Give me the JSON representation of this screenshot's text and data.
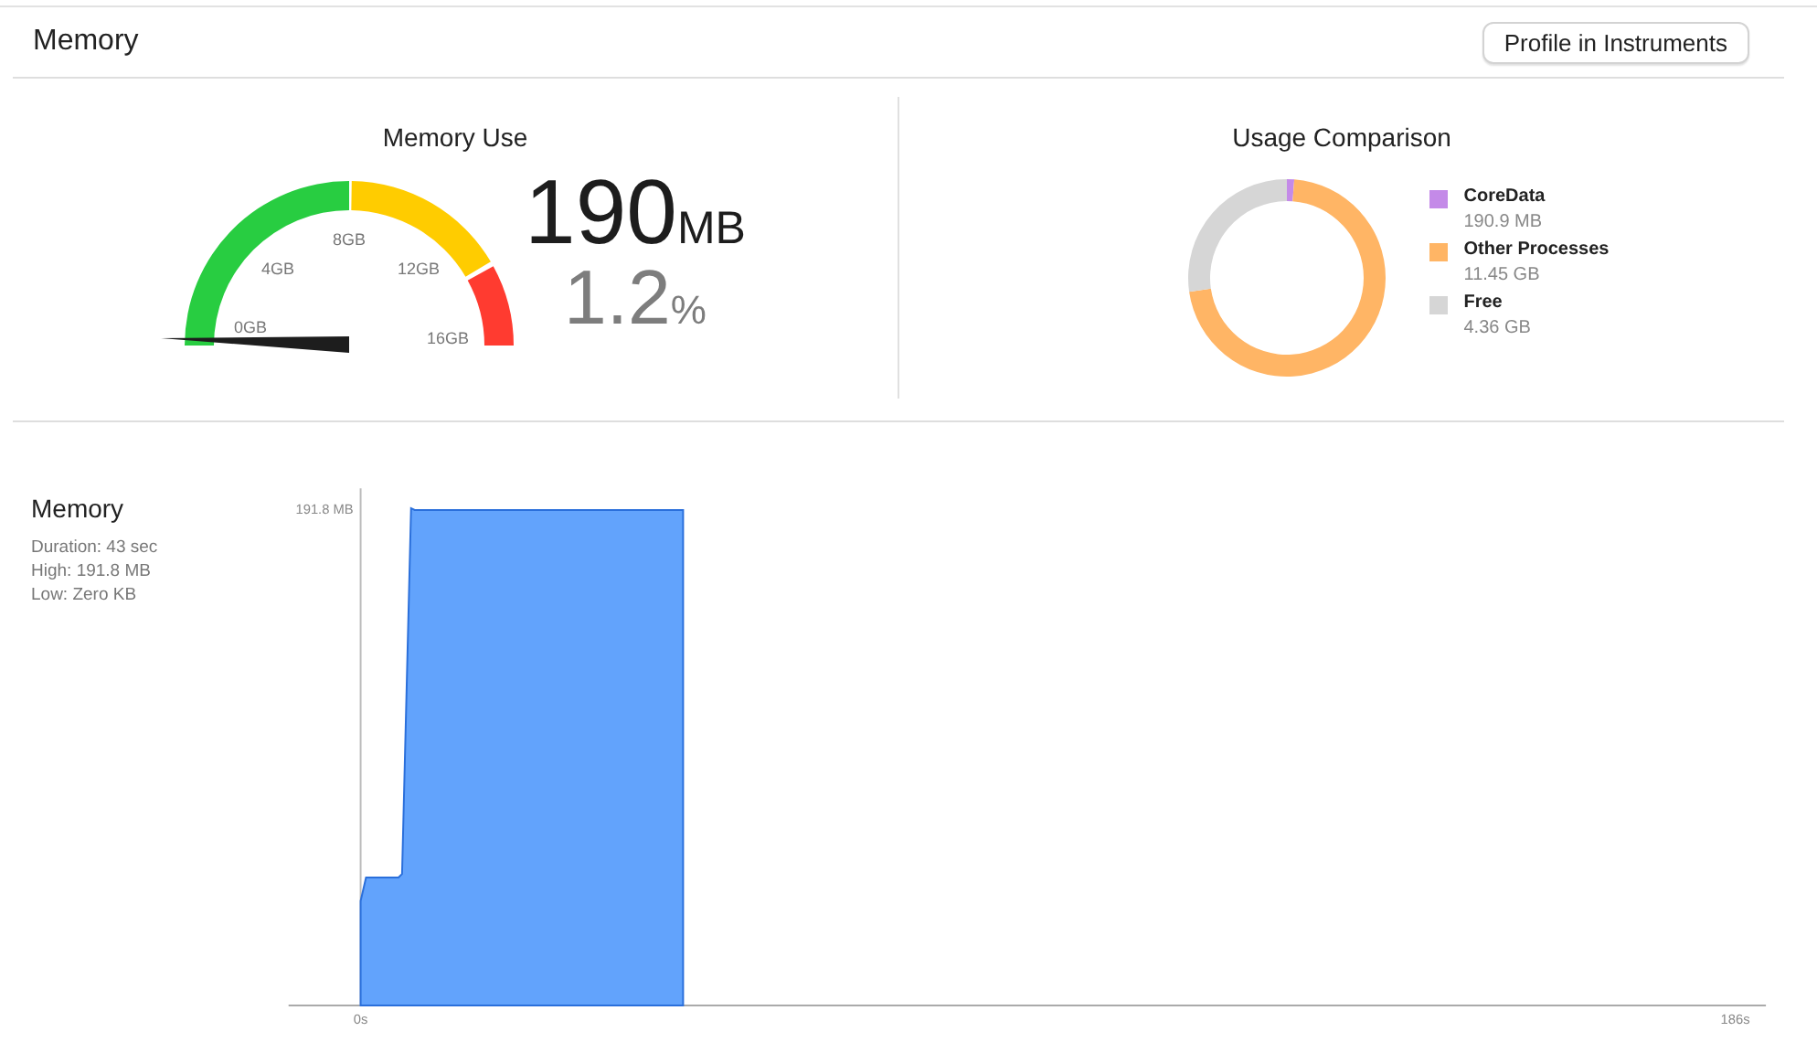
{
  "header": {
    "title": "Memory",
    "button": "Profile in Instruments"
  },
  "memory_use": {
    "title": "Memory Use",
    "gauge": {
      "ticks": [
        "0GB",
        "4GB",
        "8GB",
        "12GB",
        "16GB"
      ],
      "segments": [
        {
          "color": "#28cd41"
        },
        {
          "color": "#ffcc00"
        },
        {
          "color": "#ff3b30"
        }
      ]
    },
    "value": "190",
    "unit": "MB",
    "percent": "1.2",
    "percent_unit": "%"
  },
  "usage_comparison": {
    "title": "Usage Comparison",
    "chart_data": {
      "type": "donut",
      "categories": [
        "CoreData",
        "Other Processes",
        "Free"
      ],
      "values": [
        1.19,
        71.56,
        27.25
      ]
    },
    "legend": [
      {
        "value": "190.9 MB",
        "color": "#c48ae8"
      },
      {
        "value": "11.45 GB",
        "color": "#ffb565"
      },
      {
        "value": "4.36 GB",
        "color": "#d6d6d6"
      }
    ]
  },
  "timeline": {
    "title": "Memory",
    "details": [
      "Duration: 43 sec",
      "High: 191.8 MB",
      "Low: Zero KB"
    ],
    "y_label": "191.8 MB",
    "x_start_label": "0s",
    "x_end_label": "186s"
  }
}
